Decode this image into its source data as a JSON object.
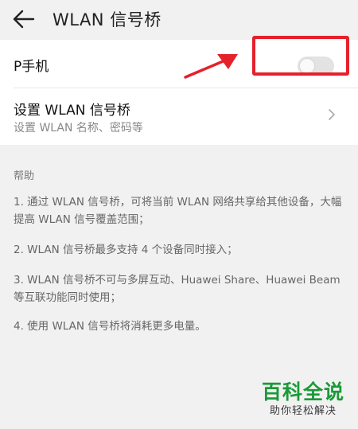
{
  "header": {
    "title": "WLAN 信号桥"
  },
  "phone_row": {
    "label": "P手机",
    "toggle_on": false
  },
  "settings_row": {
    "title": "设置 WLAN 信号桥",
    "subtitle": "设置 WLAN 名称、密码等"
  },
  "help": {
    "title": "帮助",
    "items": [
      "1. 通过 WLAN 信号桥，可将当前 WLAN 网络共享给其他设备，大幅提高 WLAN 信号覆盖范围；",
      "2. WLAN 信号桥最多支持 4 个设备同时接入；",
      "3. WLAN 信号桥不可与多屏互动、Huawei Share、Huawei Beam 等互联功能同时使用；",
      "4. 使用 WLAN 信号桥将消耗更多电量。"
    ]
  },
  "watermark": {
    "main": "百科全说",
    "sub": "助你轻松解决"
  },
  "colors": {
    "highlight": "#e5212b",
    "watermark": "#1a9a38",
    "background": "#f1f1f1"
  },
  "icons": {
    "back": "arrow-left-icon",
    "chevron": "chevron-right-icon"
  }
}
